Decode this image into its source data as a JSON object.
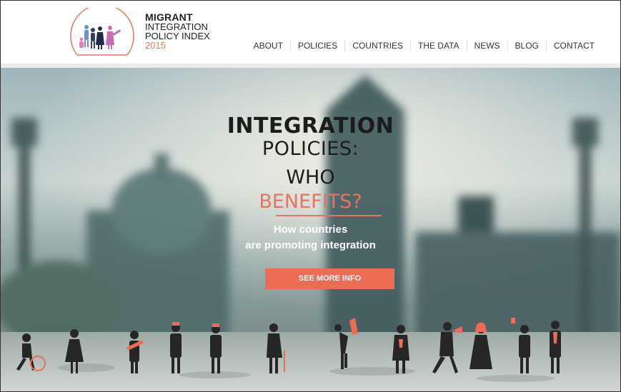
{
  "logo": {
    "line1": "MIGRANT",
    "line2": "INTEGRATION",
    "line3": "POLICY INDEX",
    "year": "2015"
  },
  "nav": {
    "items": [
      "ABOUT",
      "POLICIES",
      "COUNTRIES",
      "THE DATA",
      "NEWS",
      "BLOG",
      "CONTACT"
    ]
  },
  "hero": {
    "headline_1": "INTEGRATION",
    "headline_2": "POLICIES:",
    "headline_3": "WHO",
    "headline_4": "BENEFITS?",
    "sub_1": "How countries",
    "sub_2": "are promoting integration",
    "cta_label": "SEE MORE INFO"
  },
  "colors": {
    "accent": "#e8735e",
    "cta": "#ec6c55",
    "text_dark": "#1c1c1c"
  },
  "icons": [
    "logo-people-icon",
    "migrant-figures-illustration"
  ]
}
